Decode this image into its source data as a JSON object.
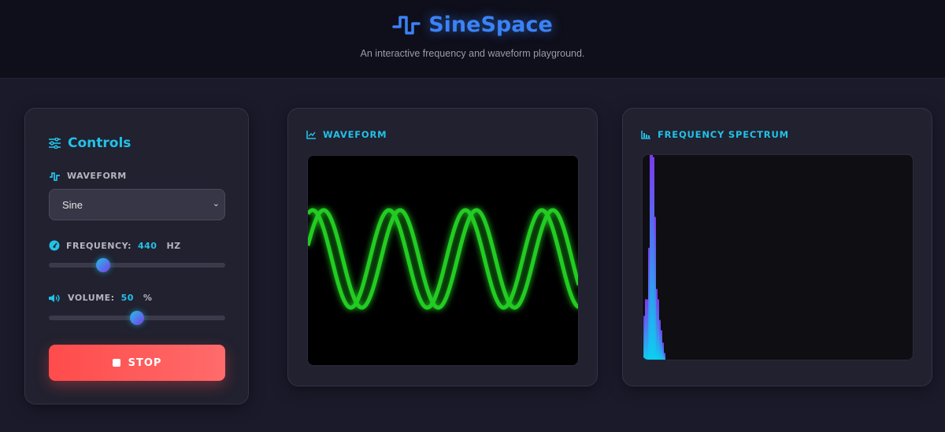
{
  "header": {
    "title": "SineSpace",
    "subtitle": "An interactive frequency and waveform playground."
  },
  "controls": {
    "title": "Controls",
    "waveform_label": "WAVEFORM",
    "waveform_value": "Sine",
    "frequency_label": "FREQUENCY:",
    "frequency_value": "440",
    "frequency_unit": "HZ",
    "frequency_fraction": 0.31,
    "volume_label": "VOLUME:",
    "volume_value": "50",
    "volume_unit": "%",
    "volume_fraction": 0.5,
    "stop_label": "STOP"
  },
  "waveform_panel": {
    "title": "WAVEFORM",
    "color": "#22cc22"
  },
  "spectrum_panel": {
    "title": "FREQUENCY SPECTRUM",
    "bars": [
      0.22,
      0.3,
      0.3,
      0.55,
      1.0,
      1.0,
      0.99,
      0.7,
      0.35,
      0.3,
      0.2,
      0.15,
      0.09,
      0.04
    ]
  },
  "colors": {
    "accent": "#22c1e8",
    "brand": "#3b82f6",
    "stop": "#ff4b4b"
  }
}
